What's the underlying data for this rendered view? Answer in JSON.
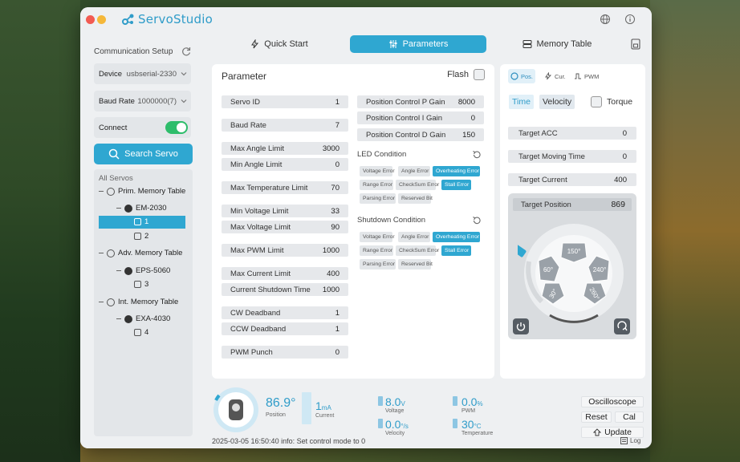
{
  "app": {
    "name": "ServoStudio"
  },
  "colors": {
    "accent": "#2fa7d1",
    "toggle_on": "#2ebd6b"
  },
  "sidebar": {
    "section_title": "Communication Setup",
    "device": {
      "label": "Device",
      "value": "usbserial-2330"
    },
    "baud": {
      "label": "Baud Rate",
      "value": "1000000(7)"
    },
    "connect": {
      "label": "Connect",
      "on": true
    },
    "search_label": "Search Servo",
    "all_servos_label": "All Servos",
    "tree": {
      "prim": {
        "label": "Prim. Memory Table",
        "model": "EM-2030",
        "ids": [
          "1",
          "2"
        ]
      },
      "adv": {
        "label": "Adv. Memory Table",
        "model": "EPS-5060",
        "ids": [
          "3"
        ]
      },
      "int": {
        "label": "Int. Memory Table",
        "model": "EXA-4030",
        "ids": [
          "4"
        ]
      }
    }
  },
  "tabs": {
    "quick_start": "Quick Start",
    "parameters": "Parameters",
    "memory_table": "Memory Table"
  },
  "parameter": {
    "title": "Parameter",
    "flash_label": "Flash",
    "left_fields": [
      {
        "label": "Servo ID",
        "value": "1"
      },
      {
        "label": "Baud Rate",
        "value": "7"
      },
      {
        "label": "Max Angle Limit",
        "value": "3000"
      },
      {
        "label": "Min Angle Limit",
        "value": "0"
      },
      {
        "label": "Max Temperature Limit",
        "value": "70"
      },
      {
        "label": "Min Voltage Limit",
        "value": "33"
      },
      {
        "label": "Max Voltage Limit",
        "value": "90"
      },
      {
        "label": "Max PWM Limit",
        "value": "1000"
      },
      {
        "label": "Max Current Limit",
        "value": "400"
      },
      {
        "label": "Current Shutdown Time",
        "value": "1000"
      },
      {
        "label": "CW Deadband",
        "value": "1"
      },
      {
        "label": "CCW Deadband",
        "value": "1"
      },
      {
        "label": "PWM Punch",
        "value": "0"
      }
    ],
    "right_fields": [
      {
        "label": "Position Control P Gain",
        "value": "8000"
      },
      {
        "label": "Position Control I Gain",
        "value": "0"
      },
      {
        "label": "Position Control D Gain",
        "value": "150"
      }
    ],
    "led_title": "LED Condition",
    "led_chips": [
      {
        "label": "Voltage Error",
        "on": false
      },
      {
        "label": "Angle Error",
        "on": false
      },
      {
        "label": "Overheating Error",
        "on": true
      },
      {
        "label": "Range Error",
        "on": false
      },
      {
        "label": "CheckSum Error",
        "on": false
      },
      {
        "label": "Stall Error",
        "on": true
      },
      {
        "label": "Parsing Error",
        "on": false
      },
      {
        "label": "Reserved Bit",
        "on": false
      }
    ],
    "shutdown_title": "Shutdown Condition",
    "shutdown_chips": [
      {
        "label": "Voltage Error",
        "on": false
      },
      {
        "label": "Angle Error",
        "on": false
      },
      {
        "label": "Overheating Error",
        "on": true
      },
      {
        "label": "Range Error",
        "on": false
      },
      {
        "label": "CheckSum Error",
        "on": false
      },
      {
        "label": "Stall Error",
        "on": true
      },
      {
        "label": "Parsing Error",
        "on": false
      },
      {
        "label": "Reserved Bit",
        "on": false
      }
    ]
  },
  "control": {
    "tabs": {
      "pos": "Pos.",
      "cur": "Cur.",
      "pwm": "PWM"
    },
    "modes": {
      "time": "Time",
      "velocity": "Velocity"
    },
    "torque_label": "Torque",
    "fields": [
      {
        "label": "Target ACC",
        "value": "0"
      },
      {
        "label": "Target Moving Time",
        "value": "0"
      },
      {
        "label": "Target Current",
        "value": "400"
      }
    ],
    "target_position": {
      "label": "Target Position",
      "value": "869"
    },
    "presets": [
      "150°",
      "60°",
      "240°",
      "30°",
      "260°"
    ]
  },
  "status": {
    "position": {
      "value": "86.9°",
      "label": "Position"
    },
    "current": {
      "value": "1",
      "unit": "mA",
      "label": "Current"
    },
    "voltage": {
      "value": "8.0",
      "unit": "V",
      "label": "Voltage"
    },
    "velocity": {
      "value": "0.0",
      "unit": "°/s",
      "label": "Velocity"
    },
    "pwm": {
      "value": "0.0",
      "unit": "%",
      "label": "PWM"
    },
    "temperature": {
      "value": "30",
      "unit": "°C",
      "label": "Temperature"
    },
    "buttons": {
      "oscilloscope": "Oscilloscope",
      "reset": "Reset",
      "cal": "Cal",
      "update": "Update"
    },
    "log_line": "2025-03-05 16:50:40 info: Set control mode to 0",
    "log_label": "Log"
  }
}
